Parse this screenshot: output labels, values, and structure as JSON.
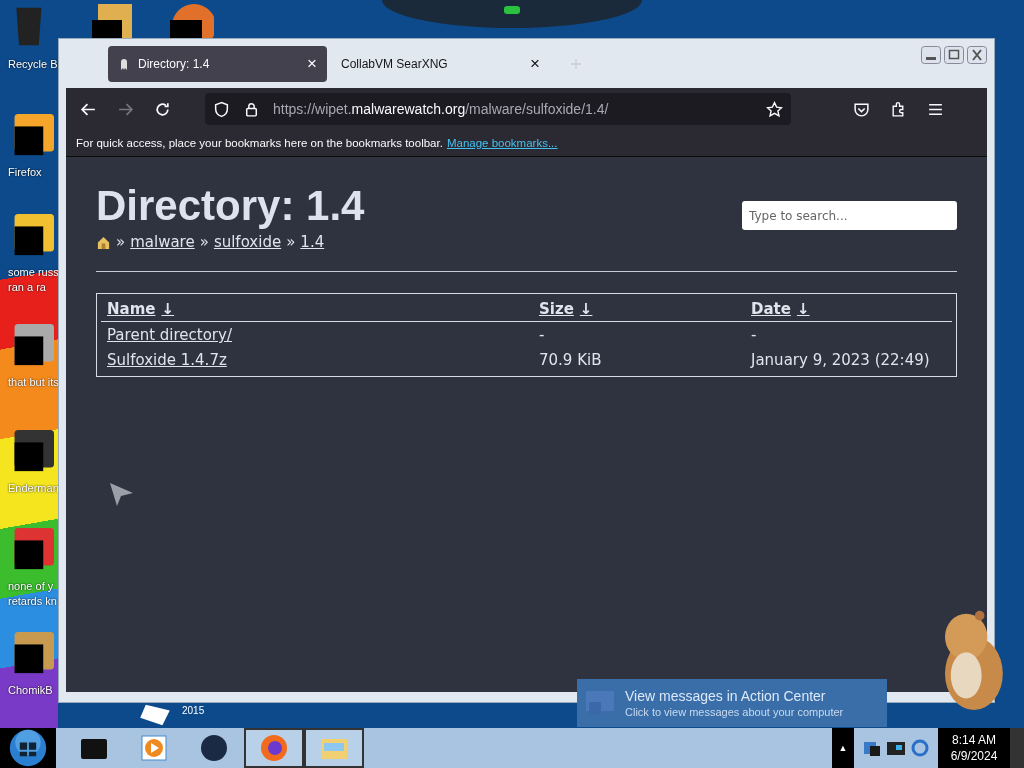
{
  "desktop": {
    "icons": [
      {
        "label": "Recycle B",
        "kind": "bin"
      },
      {
        "label": "Firefox",
        "kind": "fox"
      },
      {
        "label": "some russ\nran a ra",
        "kind": "doc"
      },
      {
        "label": "that but its",
        "kind": "stack"
      },
      {
        "label": "Enderman",
        "kind": "window"
      },
      {
        "label": "none of y\nretards kn",
        "kind": "ball"
      },
      {
        "label": "ChomikB",
        "kind": "hamster"
      }
    ],
    "stray_label": "2015"
  },
  "browser": {
    "tabs": [
      {
        "title": "Directory: 1.4",
        "selected": true
      },
      {
        "title": "CollabVM SearXNG",
        "selected": false
      }
    ],
    "close_glyph": "×",
    "url": {
      "prefix": "https://wipet.",
      "domain": "malwarewatch.org",
      "path": "/malware/sulfoxide/1.4/"
    },
    "bookmarks_bar": {
      "text": "For quick access, place your bookmarks here on the bookmarks toolbar.",
      "link": "Manage bookmarks..."
    },
    "page": {
      "heading": "Directory: 1.4",
      "search": {
        "placeholder": "Type to search..."
      },
      "breadcrumb": [
        {
          "kind": "home"
        },
        {
          "kind": "sep",
          "text": "»"
        },
        {
          "kind": "link",
          "text": "malware"
        },
        {
          "kind": "sep",
          "text": "»"
        },
        {
          "kind": "link",
          "text": "sulfoxide"
        },
        {
          "kind": "sep",
          "text": "»"
        },
        {
          "kind": "link",
          "text": "1.4"
        }
      ],
      "table": {
        "columns": [
          {
            "label": "Name",
            "arrow": "↓"
          },
          {
            "label": "Size",
            "arrow": "↓"
          },
          {
            "label": "Date",
            "arrow": "↓"
          }
        ],
        "rows": [
          {
            "name": "Parent directory/",
            "size": "-",
            "date": "-"
          },
          {
            "name": "Sulfoxide 1.4.7z",
            "size": "70.9 KiB",
            "date": "January 9, 2023 (22:49)"
          }
        ]
      }
    }
  },
  "notification": {
    "title": "View messages in Action Center",
    "body": "Click to view messages about your computer"
  },
  "taskbar": {
    "apps": [
      {
        "kind": "printer",
        "active": false
      },
      {
        "kind": "media",
        "active": false
      },
      {
        "kind": "globe",
        "active": false
      },
      {
        "kind": "fox",
        "active": true
      },
      {
        "kind": "folder",
        "active": true
      }
    ],
    "tray_arrow": "▲",
    "time": "8:14 AM",
    "date": "6/9/2024"
  }
}
